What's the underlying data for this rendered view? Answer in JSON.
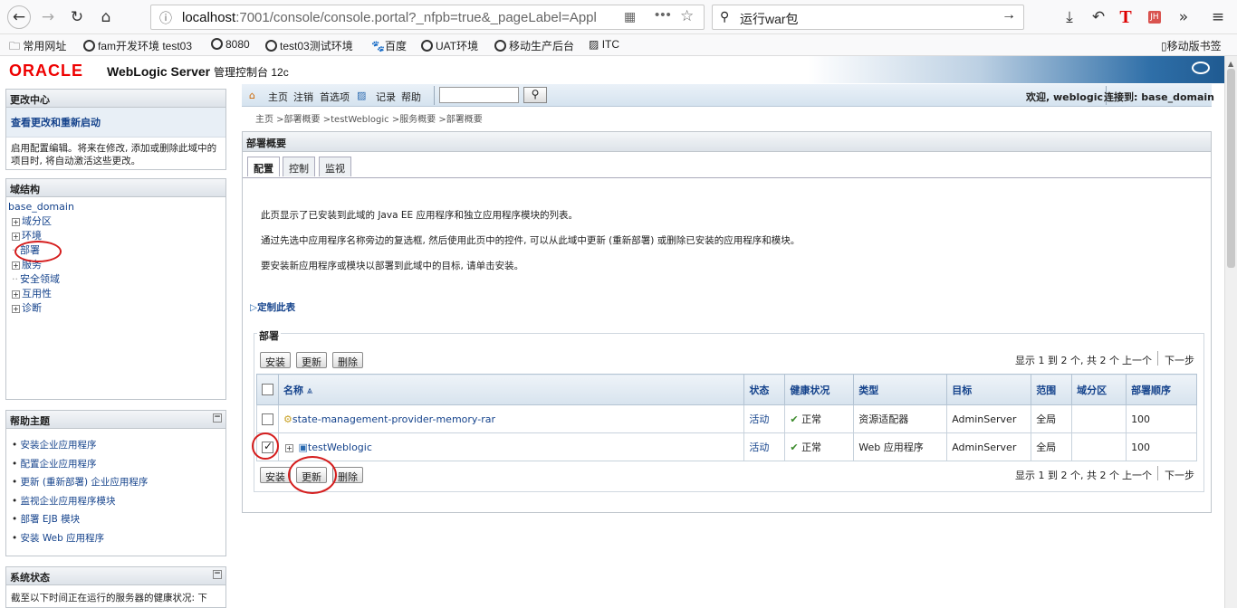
{
  "browser": {
    "url_host": "localhost",
    "url_rest": ":7001/console/console.portal?_nfpb=true&_pageLabel=Appl",
    "search_text": "运行war包"
  },
  "bookmarks": [
    "常用网址",
    "fam开发环境 test03",
    "8080",
    "test03测试环境",
    "百度",
    "UAT环境",
    "移动生产后台",
    "ITC"
  ],
  "mobile_bookmarks": "移动版书签",
  "header": {
    "logo": "ORACLE",
    "product": "WebLogic Server",
    "product_sub": "管理控制台 12c"
  },
  "change_center": {
    "title": "更改中心",
    "link": "查看更改和重新启动",
    "text": "启用配置编辑。将来在修改, 添加或删除此域中的项目时, 将自动激活这些更改。"
  },
  "domain_structure": {
    "title": "域结构",
    "root": "base_domain",
    "items": [
      "域分区",
      "环境",
      "部署",
      "服务",
      "安全领域",
      "互用性",
      "诊断"
    ]
  },
  "help": {
    "title": "帮助主题",
    "items": [
      "安装企业应用程序",
      "配置企业应用程序",
      "更新 (重新部署) 企业应用程序",
      "监视企业应用程序模块",
      "部署 EJB 模块",
      "安装 Web 应用程序"
    ]
  },
  "system_status": {
    "title": "系统状态",
    "text": "截至以下时间正在运行的服务器的健康状况: 下"
  },
  "toolbar": {
    "home": "主页",
    "logout": "注销",
    "prefs": "首选项",
    "record": "记录",
    "help": "帮助",
    "welcome": "欢迎, weblogic",
    "connected": "连接到: base_domain"
  },
  "breadcrumb": "主页 >部署概要 >testWeblogic >服务概要 >部署概要",
  "page": {
    "title": "部署概要",
    "tabs": [
      "配置",
      "控制",
      "监视"
    ],
    "desc1": "此页显示了已安装到此域的 Java EE 应用程序和独立应用程序模块的列表。",
    "desc2": "通过先选中应用程序名称旁边的复选框, 然后使用此页中的控件, 可以从此域中更新 (重新部署) 或删除已安装的应用程序和模块。",
    "desc3": "要安装新应用程序或模块以部署到此域中的目标, 请单击安装。",
    "customize": "定制此表",
    "section": "部署",
    "buttons": {
      "install": "安装",
      "update": "更新",
      "delete": "删除"
    },
    "paging": "显示 1 到 2 个, 共 2 个",
    "prev": "上一个",
    "next": "下一步"
  },
  "table": {
    "headers": [
      "名称",
      "状态",
      "健康状况",
      "类型",
      "目标",
      "范围",
      "域分区",
      "部署顺序"
    ],
    "rows": [
      {
        "name": "state-management-provider-memory-rar",
        "state": "活动",
        "health": "正常",
        "type": "资源适配器",
        "target": "AdminServer",
        "scope": "全局",
        "partition": "",
        "order": "100",
        "checked": false
      },
      {
        "name": "testWeblogic",
        "state": "活动",
        "health": "正常",
        "type": "Web 应用程序",
        "target": "AdminServer",
        "scope": "全局",
        "partition": "",
        "order": "100",
        "checked": true
      }
    ]
  },
  "colors": {
    "oracle_red": "#e00000",
    "link": "#15438c",
    "annotation_red": "#d51d1d"
  }
}
